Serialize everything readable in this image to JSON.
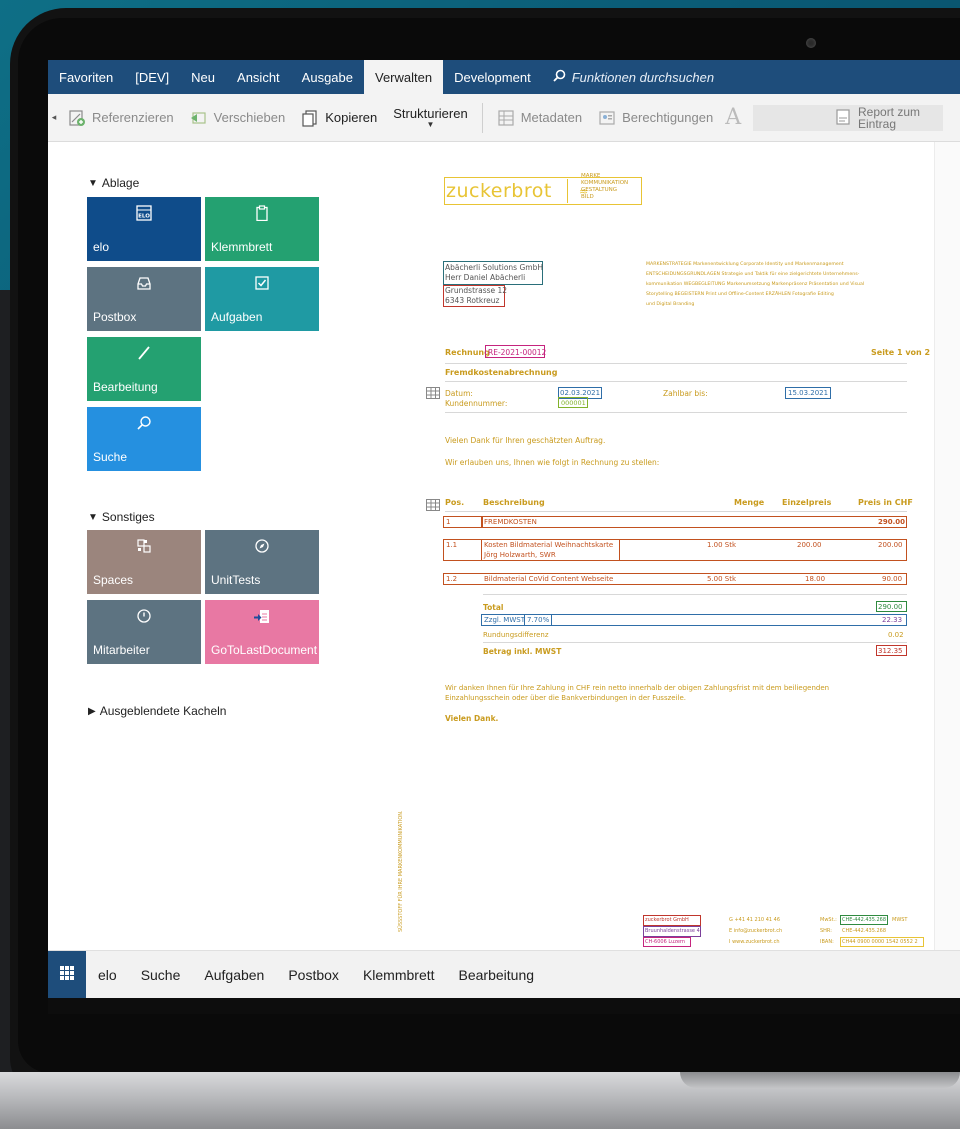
{
  "colors": {
    "menubar": "#1e4d7b",
    "tile_blue": "#0f4c8a",
    "tile_green": "#24a171",
    "tile_slate": "#5d7381",
    "tile_teal": "#1f9aa3",
    "tile_skyblue": "#2590e0",
    "tile_taupe": "#9b857d",
    "tile_pink": "#e878a3"
  },
  "menubar": {
    "items": [
      "Favoriten",
      "[DEV]",
      "Neu",
      "Ansicht",
      "Ausgabe",
      "Verwalten",
      "Development"
    ],
    "active": "Verwalten",
    "search_placeholder": "Funktionen durchsuchen"
  },
  "toolbar": {
    "referenzieren": "Referenzieren",
    "verschieben": "Verschieben",
    "kopieren": "Kopieren",
    "strukturieren": "Strukturieren",
    "metadaten": "Metadaten",
    "berechtigungen": "Berechtigungen",
    "report_line1": "Report zum",
    "report_line2": "Eintrag"
  },
  "sections": {
    "ablage": "Ablage",
    "sonstiges": "Sonstiges",
    "ausgeblendete": "Ausgeblendete Kacheln"
  },
  "tiles": {
    "elo": "elo",
    "klemmbrett": "Klemmbrett",
    "postbox": "Postbox",
    "aufgaben": "Aufgaben",
    "bearbeitung": "Bearbeitung",
    "suche": "Suche",
    "spaces": "Spaces",
    "unittests": "UnitTests",
    "mitarbeiter": "Mitarbeiter",
    "gotolast": "GoToLastDocument"
  },
  "document": {
    "logo": "zuckerbrot",
    "logo_tag": [
      "MARKE",
      "KOMMUNIKATION",
      "GESTALTUNG",
      "BILD"
    ],
    "recipient_1": "Abächerli Solutions GmbH",
    "recipient_2": "Herr Daniel Abächerli",
    "recipient_3": "Grundstrasse 12",
    "recipient_4": "6343 Rotkreuz",
    "blurb_1": "MARKENSTRATEGIE Markenentwicklung Corporate Identity und Markenmanagement",
    "blurb_2": "ENTSCHEIDUNGSGRUNDLAGEN Strategie und Taktik für eine zielgerichtete Unternehmens-",
    "blurb_3": "kommunikation WEGBEGLEITUNG Markenumsetzung Markenpräsenz Präsentation und Visual",
    "blurb_4": "Storytelling BEGEISTERN Print und Offline-Content ERZÄHLEN Fotografie Editing",
    "blurb_5": "und Digital Branding",
    "rechnung_label": "Rechnung",
    "rechnung_nr": "RE-2021-00012",
    "seite": "Seite 1 von 2",
    "fremdkosten_title": "Fremdkostenabrechnung",
    "datum_label": "Datum:",
    "datum_value": "02.03.2021",
    "zahlbar_label": "Zahlbar bis:",
    "zahlbar_value": "15.03.2021",
    "kundennr_label": "Kundennummer:",
    "kundennr_value": "000001",
    "dank_1": "Vielen Dank für Ihren geschätzten Auftrag.",
    "dank_2": "Wir erlauben uns, Ihnen wie folgt in Rechnung zu stellen:",
    "col_pos": "Pos.",
    "col_beschreibung": "Beschreibung",
    "col_menge": "Menge",
    "col_einzelpreis": "Einzelpreis",
    "col_preis": "Preis in CHF",
    "row1_pos": "1",
    "row1_desc": "FREMDKOSTEN",
    "row1_preis": "290.00",
    "row11_pos": "1.1",
    "row11_desc_1": "Kosten Bildmaterial Weihnachtskarte",
    "row11_desc_2": "Jörg Holzwarth, SWR",
    "row11_menge": "1.00 Stk",
    "row11_einzel": "200.00",
    "row11_preis": "200.00",
    "row12_pos": "1.2",
    "row12_desc": "Bildmaterial CoVid Content Webseite",
    "row12_menge": "5.00 Stk",
    "row12_einzel": "18.00",
    "row12_preis": "90.00",
    "total_label": "Total",
    "total_value": "290.00",
    "mwst_label": "Zzgl. MWST",
    "mwst_rate": "7.70%",
    "mwst_value": "22.33",
    "rundung_label": "Rundungsdifferenz",
    "rundung_value": "0.02",
    "betrag_label": "Betrag inkl. MWST",
    "betrag_value": "312.35",
    "zahlung_1": "Wir danken Ihnen für Ihre Zahlung in CHF rein netto innerhalb der obigen Zahlungsfrist mit dem beiliegenden",
    "zahlung_2": "Einzahlungsschein oder über die Bankverbindungen in der Fusszeile.",
    "vielen_dank": "Vielen Dank.",
    "vertical_text": "SÜSSSTOFF FÜR IHRE MARKENKOMMUNIKATION.",
    "footer_company_1": "zuckerbrot GmbH",
    "footer_company_2": "Bruunhaldenstrasse 4",
    "footer_company_3": "CH-6006 Luzern",
    "footer_contact_1": "G  +41 41 210 41 46",
    "footer_contact_2": "E  info@zuckerbrot.ch",
    "footer_contact_3": "I   www.zuckerbrot.ch",
    "footer_mwst_label": "MwSt.:",
    "footer_mwst_value": "CHE-442.435.268",
    "footer_mwst_suffix": "MWST",
    "footer_shr_label": "SHR:",
    "footer_shr_value": "CHE-442.435.268",
    "footer_iban_label": "IBAN:",
    "footer_iban_value": "CH44 0900 0000 1542 0552 2"
  },
  "taskbar": {
    "items": [
      "elo",
      "Suche",
      "Aufgaben",
      "Postbox",
      "Klemmbrett",
      "Bearbeitung"
    ]
  }
}
